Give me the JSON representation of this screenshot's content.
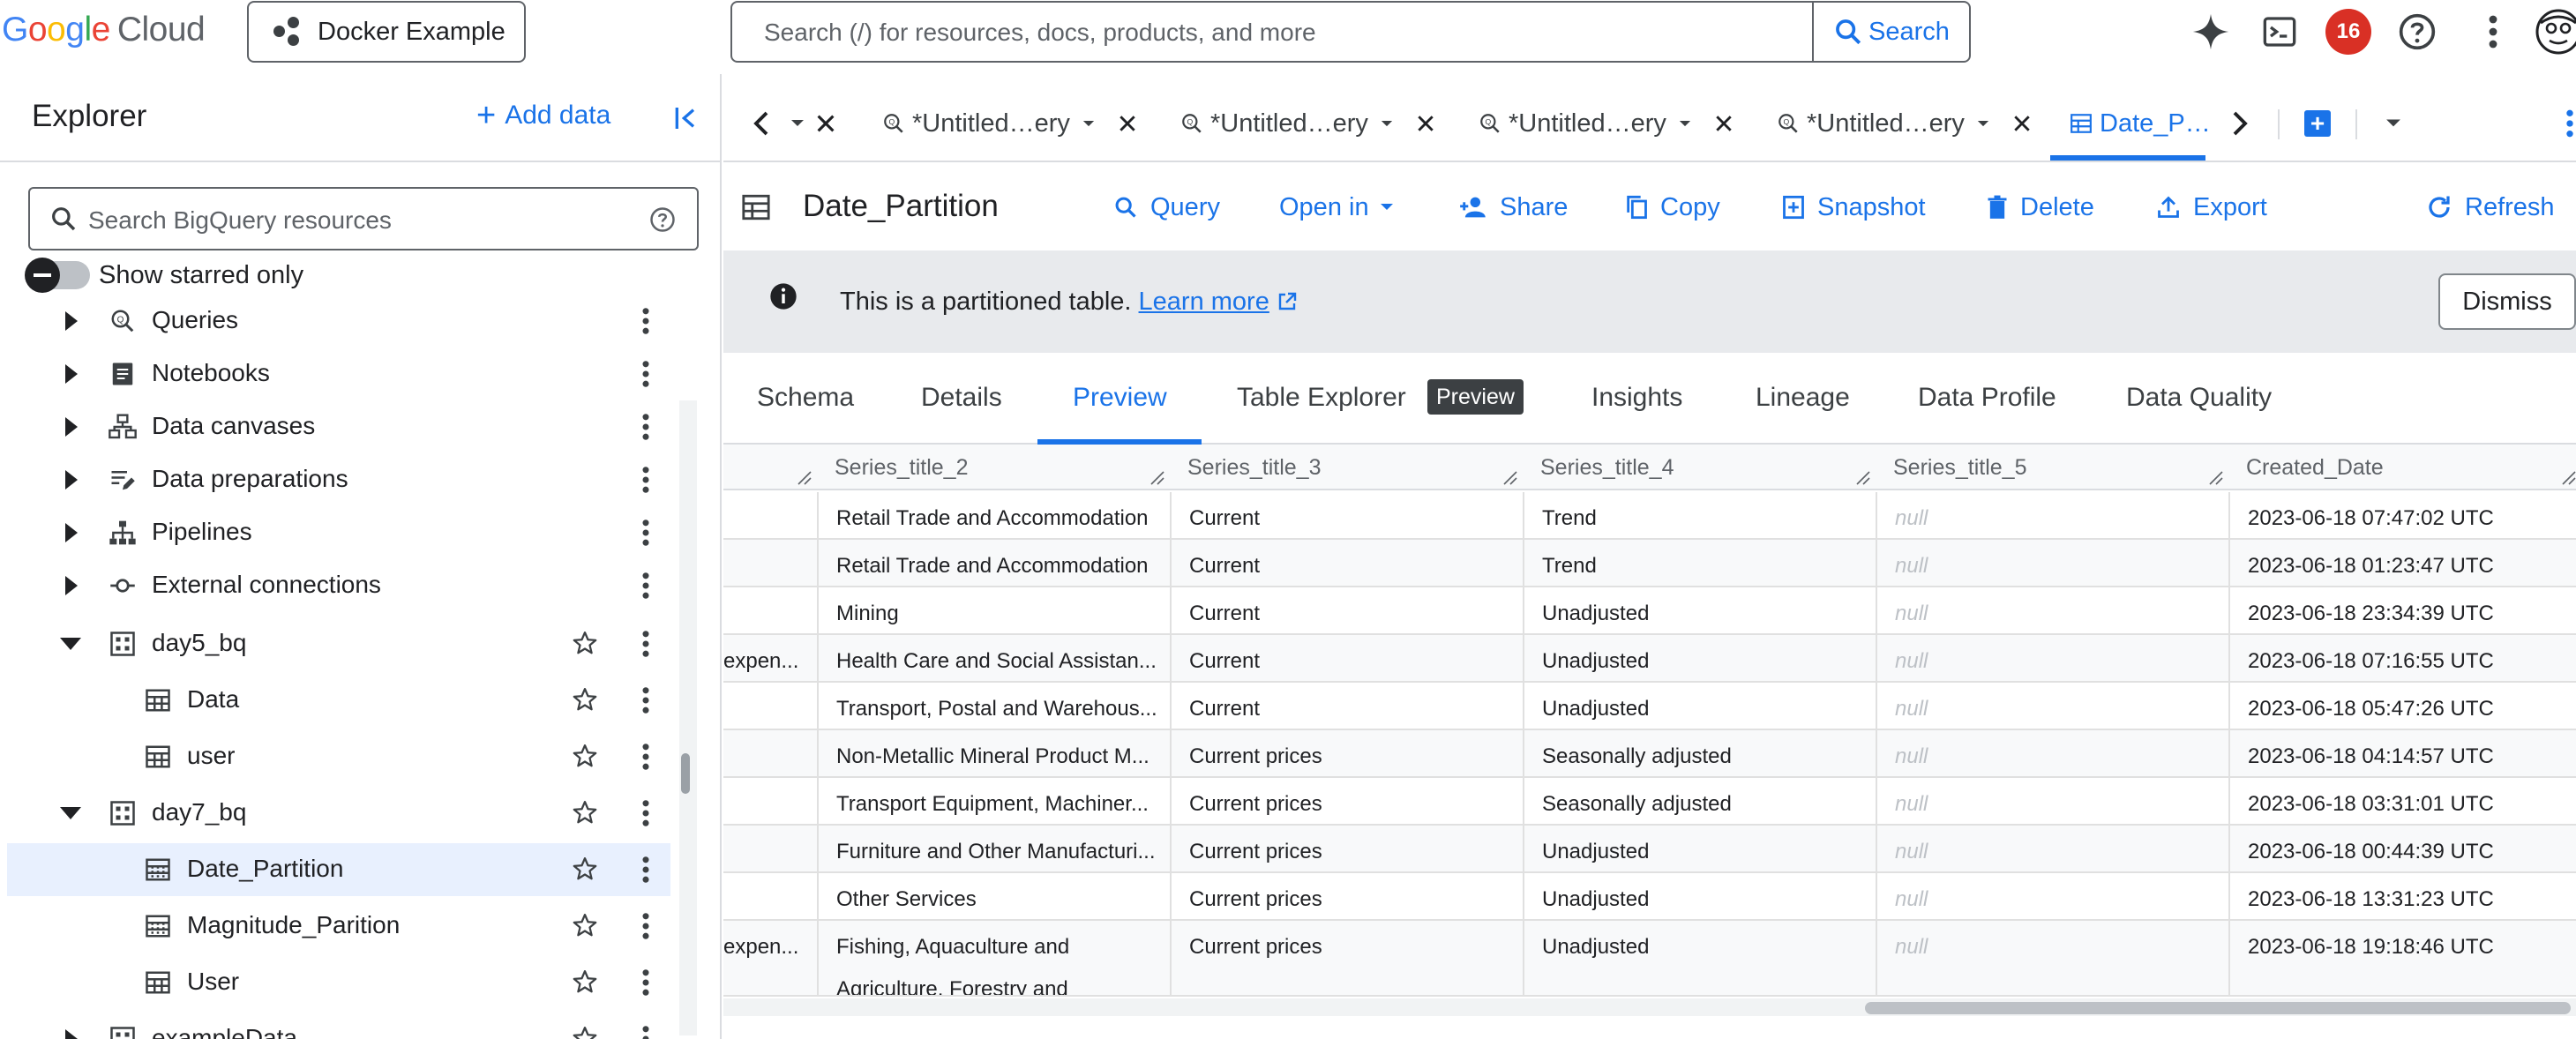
{
  "brand": {
    "google": "Google",
    "cloud": "Cloud"
  },
  "project": {
    "name": "Docker Example"
  },
  "search": {
    "placeholder": "Search (/) for resources, docs, products, and more",
    "button": "Search"
  },
  "notifications": {
    "count": "16"
  },
  "colors": {
    "accent": "#1a73e8",
    "badge": "#d93025",
    "selected_row": "#e8f0fe",
    "banner": "#e8eaed"
  },
  "sidebar": {
    "title": "Explorer",
    "add_data": "Add data",
    "search_placeholder": "Search BigQuery resources",
    "show_starred": "Show starred only",
    "items": [
      {
        "label": "Queries",
        "icon": "queries-icon",
        "expand": "right",
        "level": 0
      },
      {
        "label": "Notebooks",
        "icon": "notebook-icon",
        "expand": "right",
        "level": 0
      },
      {
        "label": "Data canvases",
        "icon": "data-canvas-icon",
        "expand": "right",
        "level": 0
      },
      {
        "label": "Data preparations",
        "icon": "data-preparation-icon",
        "expand": "right",
        "level": 0
      },
      {
        "label": "Pipelines",
        "icon": "pipeline-icon",
        "expand": "right",
        "level": 0
      },
      {
        "label": "External connections",
        "icon": "external-connection-icon",
        "expand": "right",
        "level": 0
      },
      {
        "label": "day5_bq",
        "icon": "dataset-icon",
        "expand": "down",
        "level": 0,
        "star": true
      },
      {
        "label": "Data",
        "icon": "table-icon",
        "level": 1,
        "star": true
      },
      {
        "label": "user",
        "icon": "table-icon",
        "level": 1,
        "star": true
      },
      {
        "label": "day7_bq",
        "icon": "dataset-icon",
        "expand": "down",
        "level": 0,
        "star": true
      },
      {
        "label": "Date_Partition",
        "icon": "partitioned-table-icon",
        "level": 1,
        "star": true,
        "selected": true
      },
      {
        "label": "Magnitude_Parition",
        "icon": "partitioned-table-icon",
        "level": 1,
        "star": true
      },
      {
        "label": "User",
        "icon": "table-icon",
        "level": 1,
        "star": true
      },
      {
        "label": "exampleData",
        "icon": "dataset-icon",
        "expand": "right",
        "level": 0,
        "star": true
      }
    ]
  },
  "tabs": [
    {
      "label": "*Untitled…ery"
    },
    {
      "label": "*Untitled…ery"
    },
    {
      "label": "*Untitled…ery"
    },
    {
      "label": "*Untitled…ery"
    },
    {
      "label": "Date_P…",
      "active": true
    }
  ],
  "table": {
    "title": "Date_Partition",
    "actions": {
      "query": "Query",
      "open_in": "Open in",
      "share": "Share",
      "copy": "Copy",
      "snapshot": "Snapshot",
      "delete": "Delete",
      "export": "Export",
      "refresh": "Refresh"
    }
  },
  "banner": {
    "text": "This is a partitioned table.",
    "link": "Learn more",
    "dismiss": "Dismiss"
  },
  "subtabs": {
    "schema": "Schema",
    "details": "Details",
    "preview": "Preview",
    "table_explorer": "Table Explorer",
    "preview_chip": "Preview",
    "insights": "Insights",
    "lineage": "Lineage",
    "data_profile": "Data Profile",
    "data_quality": "Data Quality"
  },
  "grid": {
    "columns": [
      "Series_title_2",
      "Series_title_3",
      "Series_title_4",
      "Series_title_5",
      "Created_Date"
    ],
    "rows": [
      {
        "c0": "",
        "c1": "Retail Trade and Accommodation",
        "c2": "Current",
        "c3": "Trend",
        "c4": "null",
        "c5": "2023-06-18 07:47:02 UTC"
      },
      {
        "c0": "",
        "c1": "Retail Trade and Accommodation",
        "c2": "Current",
        "c3": "Trend",
        "c4": "null",
        "c5": "2023-06-18 01:23:47 UTC"
      },
      {
        "c0": "",
        "c1": "Mining",
        "c2": "Current",
        "c3": "Unadjusted",
        "c4": "null",
        "c5": "2023-06-18 23:34:39 UTC"
      },
      {
        "c0": "expen...",
        "c1": "Health Care and Social Assistan...",
        "c2": "Current",
        "c3": "Unadjusted",
        "c4": "null",
        "c5": "2023-06-18 07:16:55 UTC"
      },
      {
        "c0": "",
        "c1": "Transport, Postal and Warehous...",
        "c2": "Current",
        "c3": "Unadjusted",
        "c4": "null",
        "c5": "2023-06-18 05:47:26 UTC"
      },
      {
        "c0": "",
        "c1": "Non-Metallic Mineral Product M...",
        "c2": "Current prices",
        "c3": "Seasonally adjusted",
        "c4": "null",
        "c5": "2023-06-18 04:14:57 UTC"
      },
      {
        "c0": "",
        "c1": "Transport Equipment, Machiner...",
        "c2": "Current prices",
        "c3": "Seasonally adjusted",
        "c4": "null",
        "c5": "2023-06-18 03:31:01 UTC"
      },
      {
        "c0": "",
        "c1": "Furniture and Other Manufacturi...",
        "c2": "Current prices",
        "c3": "Unadjusted",
        "c4": "null",
        "c5": "2023-06-18 00:44:39 UTC"
      },
      {
        "c0": "",
        "c1": "Other Services",
        "c2": "Current prices",
        "c3": "Unadjusted",
        "c4": "null",
        "c5": "2023-06-18 13:31:23 UTC"
      },
      {
        "c0": "expen...",
        "c1": "Fishing, Aquaculture and",
        "c1b": "Agriculture, Forestry and",
        "c2": "Current prices",
        "c3": "Unadjusted",
        "c4": "null",
        "c5": "2023-06-18 19:18:46 UTC"
      }
    ]
  }
}
